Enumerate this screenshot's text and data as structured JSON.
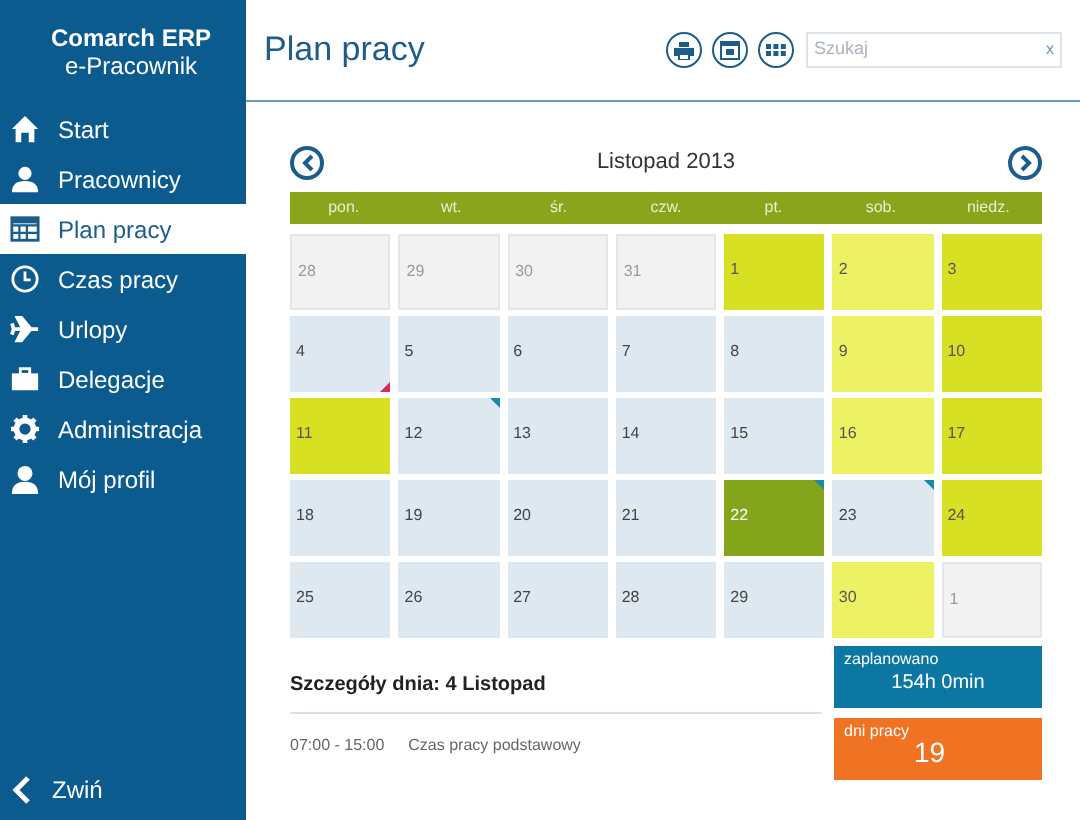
{
  "brand": {
    "line_1": "Comarch ERP",
    "line_2": "e-Pracownik"
  },
  "sidebar": {
    "items": [
      {
        "label": "Start",
        "selected": false
      },
      {
        "label": "Pracownicy",
        "selected": false
      },
      {
        "label": "Plan pracy",
        "selected": true
      },
      {
        "label": "Czas pracy",
        "selected": false
      },
      {
        "label": "Urlopy",
        "selected": false
      },
      {
        "label": "Delegacje",
        "selected": false
      },
      {
        "label": "Administracja",
        "selected": false
      },
      {
        "label": "Mój profil",
        "selected": false
      }
    ],
    "collapse": "Zwiń"
  },
  "header": {
    "title": "Plan pracy",
    "search": {
      "placeholder": "Szukaj",
      "clear": "x"
    }
  },
  "calendar": {
    "month": "Listopad 2013",
    "weekdays": [
      "pon.",
      "wt.",
      "śr.",
      "czw.",
      "pt.",
      "sob.",
      "niedz."
    ],
    "days": [
      {
        "day": "28",
        "kind": "other"
      },
      {
        "day": "29",
        "kind": "other"
      },
      {
        "day": "30",
        "kind": "other"
      },
      {
        "day": "31",
        "kind": "other"
      },
      {
        "day": "1",
        "kind": "holiday"
      },
      {
        "day": "2",
        "kind": "free"
      },
      {
        "day": "3",
        "kind": "holiday"
      },
      {
        "day": "4",
        "kind": "work",
        "flag": {
          "kind": "alert",
          "color": "#e0245e"
        }
      },
      {
        "day": "5",
        "kind": "work"
      },
      {
        "day": "6",
        "kind": "work"
      },
      {
        "day": "7",
        "kind": "work"
      },
      {
        "day": "8",
        "kind": "work"
      },
      {
        "day": "9",
        "kind": "free"
      },
      {
        "day": "10",
        "kind": "holiday"
      },
      {
        "day": "11",
        "kind": "holiday"
      },
      {
        "day": "12",
        "kind": "work",
        "flag": {
          "kind": "note",
          "color": "#1a8aa8"
        }
      },
      {
        "day": "13",
        "kind": "work"
      },
      {
        "day": "14",
        "kind": "work"
      },
      {
        "day": "15",
        "kind": "work"
      },
      {
        "day": "16",
        "kind": "free"
      },
      {
        "day": "17",
        "kind": "holiday"
      },
      {
        "day": "18",
        "kind": "work"
      },
      {
        "day": "19",
        "kind": "work"
      },
      {
        "day": "20",
        "kind": "work"
      },
      {
        "day": "21",
        "kind": "work"
      },
      {
        "day": "22",
        "kind": "highlight",
        "flag": {
          "kind": "note",
          "color": "#1a8aa8"
        }
      },
      {
        "day": "23",
        "kind": "work",
        "flag": {
          "kind": "note",
          "color": "#1a8aa8"
        }
      },
      {
        "day": "24",
        "kind": "holiday"
      },
      {
        "day": "25",
        "kind": "work"
      },
      {
        "day": "26",
        "kind": "work"
      },
      {
        "day": "27",
        "kind": "work"
      },
      {
        "day": "28",
        "kind": "work"
      },
      {
        "day": "29",
        "kind": "work"
      },
      {
        "day": "30",
        "kind": "free"
      },
      {
        "day": "1",
        "kind": "other"
      }
    ]
  },
  "details": {
    "title": "Szczegóły dnia: 4 Listopad",
    "entries": [
      {
        "time": "07:00 - 15:00",
        "label": "Czas pracy podstawowy"
      }
    ]
  },
  "stats": [
    {
      "label": "zaplanowano",
      "value": "154h 0min",
      "kind": "planned"
    },
    {
      "label": "dni pracy",
      "value": "19",
      "kind": "days"
    }
  ]
}
